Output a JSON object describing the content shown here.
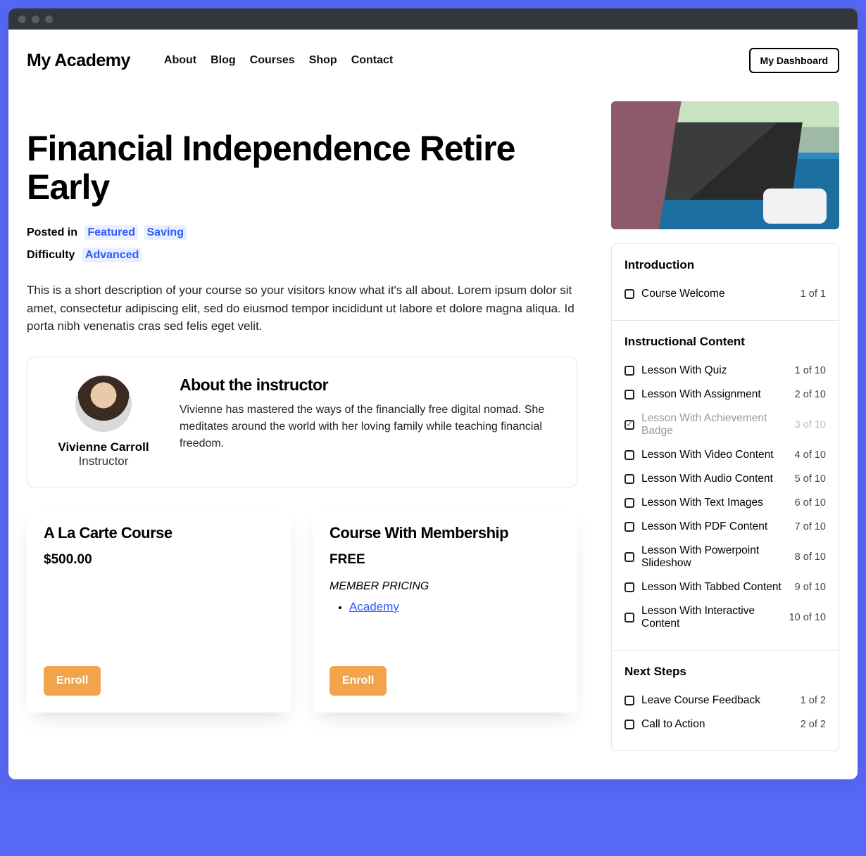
{
  "brand": "My Academy",
  "nav": [
    "About",
    "Blog",
    "Courses",
    "Shop",
    "Contact"
  ],
  "dashboard_btn": "My Dashboard",
  "course": {
    "title": "Financial Independence Retire Early",
    "posted_in_label": "Posted in",
    "tags": [
      "Featured",
      "Saving"
    ],
    "difficulty_label": "Difficulty",
    "difficulty": "Advanced",
    "description": "This is a short description of your course so your visitors know what it's all about. Lorem ipsum dolor sit amet, consectetur adipiscing elit, sed do eiusmod tempor incididunt ut labore et dolore magna aliqua. Id porta nibh venenatis cras sed felis eget velit."
  },
  "instructor": {
    "heading": "About the instructor",
    "name": "Vivienne Carroll",
    "role": "Instructor",
    "bio": "Vivienne has mastered the ways of the financially free digital nomad. She meditates around the world with her loving family while teaching financial freedom."
  },
  "pricing": [
    {
      "title": "A La Carte Course",
      "price": "$500.00",
      "member_pricing_label": null,
      "memberships": [],
      "enroll": "Enroll"
    },
    {
      "title": "Course With Membership",
      "price": "FREE",
      "member_pricing_label": "MEMBER PRICING",
      "memberships": [
        "Academy"
      ],
      "enroll": "Enroll"
    }
  ],
  "syllabus": [
    {
      "title": "Introduction",
      "items": [
        {
          "label": "Course Welcome",
          "count": "1 of 1",
          "done": false
        }
      ]
    },
    {
      "title": "Instructional Content",
      "items": [
        {
          "label": "Lesson With Quiz",
          "count": "1 of 10",
          "done": false
        },
        {
          "label": "Lesson With Assignment",
          "count": "2 of 10",
          "done": false
        },
        {
          "label": "Lesson With Achievement Badge",
          "count": "3 of 10",
          "done": true
        },
        {
          "label": "Lesson With Video Content",
          "count": "4 of 10",
          "done": false
        },
        {
          "label": "Lesson With Audio Content",
          "count": "5 of 10",
          "done": false
        },
        {
          "label": "Lesson With Text Images",
          "count": "6 of 10",
          "done": false
        },
        {
          "label": "Lesson With PDF Content",
          "count": "7 of 10",
          "done": false
        },
        {
          "label": "Lesson With Powerpoint Slideshow",
          "count": "8 of 10",
          "done": false
        },
        {
          "label": "Lesson With Tabbed Content",
          "count": "9 of 10",
          "done": false
        },
        {
          "label": "Lesson With Interactive Content",
          "count": "10 of 10",
          "done": false
        }
      ]
    },
    {
      "title": "Next Steps",
      "items": [
        {
          "label": "Leave Course Feedback",
          "count": "1 of 2",
          "done": false
        },
        {
          "label": "Call to Action",
          "count": "2 of 2",
          "done": false
        }
      ]
    }
  ]
}
